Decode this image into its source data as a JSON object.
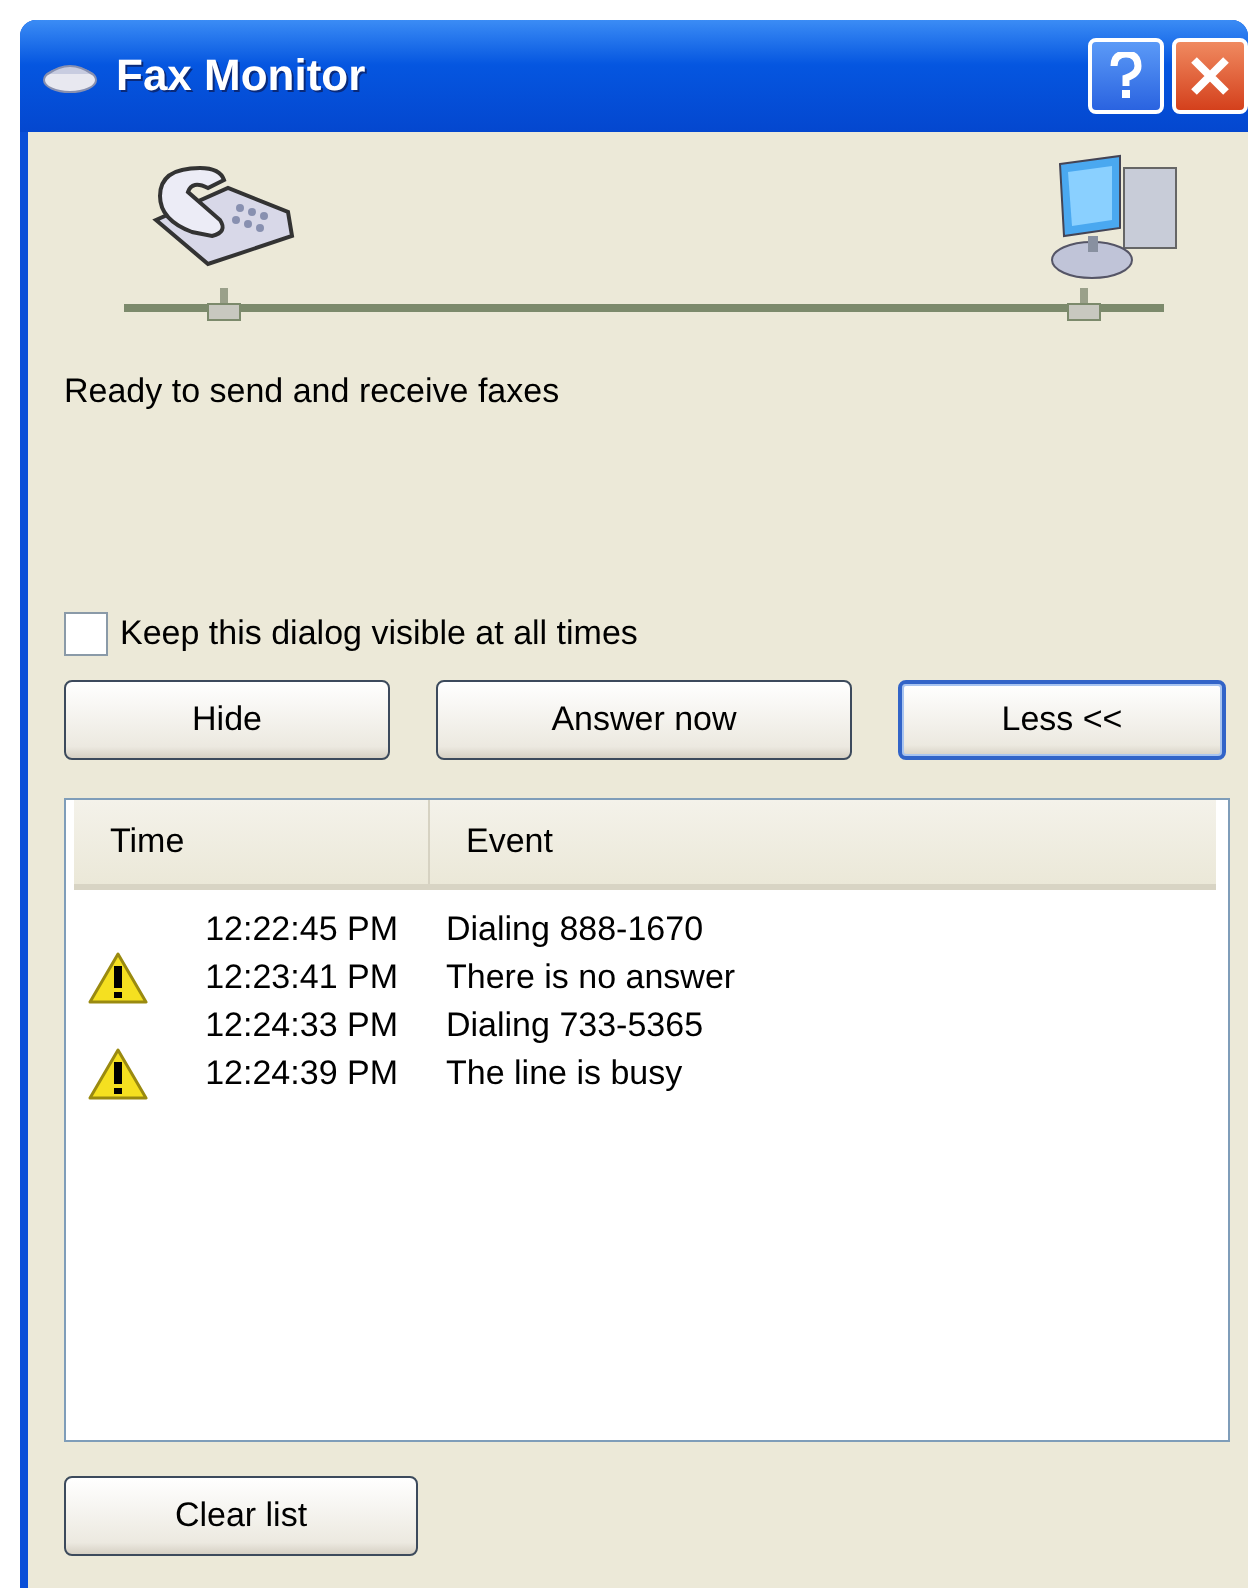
{
  "window": {
    "title": "Fax Monitor"
  },
  "status": "Ready to send and receive faxes",
  "keep_visible": {
    "label": "Keep this dialog visible at all times",
    "checked": false
  },
  "buttons": [
    {
      "label": "Hide",
      "default": false
    },
    {
      "label": "Answer now",
      "default": false
    },
    {
      "label": "Less <<",
      "default": true
    }
  ],
  "table": {
    "columns": [
      "Time",
      "Event"
    ],
    "rows": [
      {
        "kind": "plain",
        "time": "12:22:45 PM",
        "event": "Dialing 888-1670"
      },
      {
        "kind": "warning",
        "time": "12:23:41 PM",
        "event": "There is no answer"
      },
      {
        "kind": "plain",
        "time": "12:24:33 PM",
        "event": "Dialing 733-5365"
      },
      {
        "kind": "warning",
        "time": "12:24:39 PM",
        "event": "The line is busy"
      }
    ]
  },
  "clear_button": "Clear list"
}
